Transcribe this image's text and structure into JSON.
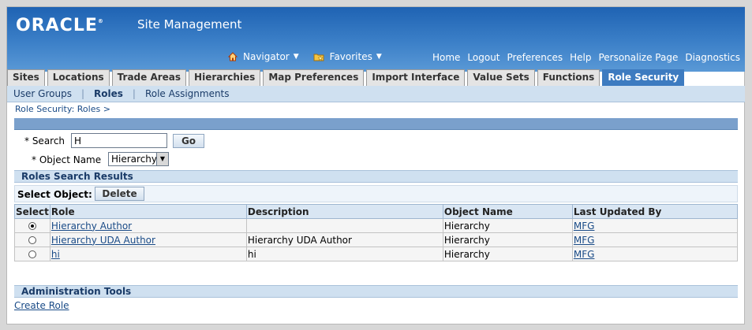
{
  "header": {
    "logo": "ORACLE",
    "logo_reg": "®",
    "app_name": "Site Management",
    "navigator": "Navigator",
    "favorites": "Favorites",
    "links": [
      "Home",
      "Logout",
      "Preferences",
      "Help",
      "Personalize Page",
      "Diagnostics"
    ]
  },
  "tabs": [
    "Sites",
    "Locations",
    "Trade Areas",
    "Hierarchies",
    "Map Preferences",
    "Import Interface",
    "Value Sets",
    "Functions",
    "Role Security"
  ],
  "active_tab": "Role Security",
  "subtabs": [
    "User Groups",
    "Roles",
    "Role Assignments"
  ],
  "active_subtab": "Roles",
  "breadcrumb": {
    "item": "Role Security: Roles",
    "sep": ">"
  },
  "search": {
    "search_label": "* Search",
    "search_value": "H",
    "go_label": "Go",
    "object_label": "* Object Name",
    "object_value": "Hierarchy"
  },
  "results": {
    "title": "Roles Search Results",
    "select_object_label": "Select Object:",
    "delete_label": "Delete",
    "columns": [
      "Select",
      "Role",
      "Description",
      "Object Name",
      "Last Updated By"
    ],
    "rows": [
      {
        "selected": true,
        "role": "Hierarchy Author",
        "description": "",
        "object": "Hierarchy",
        "updated_by": "MFG"
      },
      {
        "selected": false,
        "role": "Hierarchy UDA Author",
        "description": "Hierarchy UDA Author",
        "object": "Hierarchy",
        "updated_by": "MFG"
      },
      {
        "selected": false,
        "role": "hi",
        "description": "hi",
        "object": "Hierarchy",
        "updated_by": "MFG"
      }
    ]
  },
  "admin": {
    "title": "Administration Tools",
    "create_role": "Create Role"
  },
  "colors": {
    "brand": "#2f72be",
    "active_tab": "#3d7bc0",
    "subtab_bg": "#cfe0f0",
    "link": "#1a4b87"
  }
}
